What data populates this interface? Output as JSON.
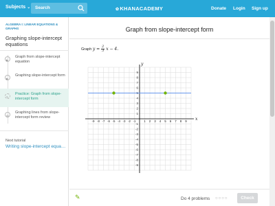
{
  "colors": {
    "topbar": "#28a8d8",
    "link": "#2c8ebf",
    "active_bg": "#e6f4f0",
    "active_text": "#29a08a",
    "line": "#6495ed",
    "point": "#71b307",
    "check_button": "#d6d8da"
  },
  "topbar": {
    "subjects_label": "Subjects",
    "search_placeholder": "Search",
    "logo": "KHANACADEMY",
    "donate": "Donate",
    "login": "Login",
    "signup": "Sign up"
  },
  "sidebar": {
    "breadcrumb": "ALGEBRA I: LINEAR EQUATIONS & GRAPHS",
    "lesson_title": "Graphing slope-intercept equations",
    "items": [
      {
        "label": "Graph from slope-intercept equation",
        "icon": "video-icon"
      },
      {
        "label": "Graphing slope-intercept form",
        "icon": "video-icon"
      },
      {
        "label": "Practice: Graph from slope-intercept form",
        "icon": "exercise-icon"
      },
      {
        "label": "Graphing lines from slope-intercept form review",
        "icon": "article-icon"
      }
    ],
    "next_label": "Next tutorial",
    "next_link": "Writing slope-intercept equations"
  },
  "exercise": {
    "title": "Graph from slope-intercept form",
    "prompt_prefix": "Graph",
    "eq_lhs": "y =",
    "eq_num": "2",
    "eq_den": "3",
    "eq_rhs": "x − 4."
  },
  "graph": {
    "x_range": [
      -10,
      10
    ],
    "y_range": [
      -10,
      10
    ],
    "x_axis_label": "x",
    "y_axis_label": "y",
    "line_y": 5,
    "points": [
      {
        "x": -5,
        "y": 5
      },
      {
        "x": 5,
        "y": 5
      }
    ]
  },
  "bottom": {
    "do_problems": "Do 4 problems",
    "dots": "○○○○",
    "check_label": "Check"
  }
}
